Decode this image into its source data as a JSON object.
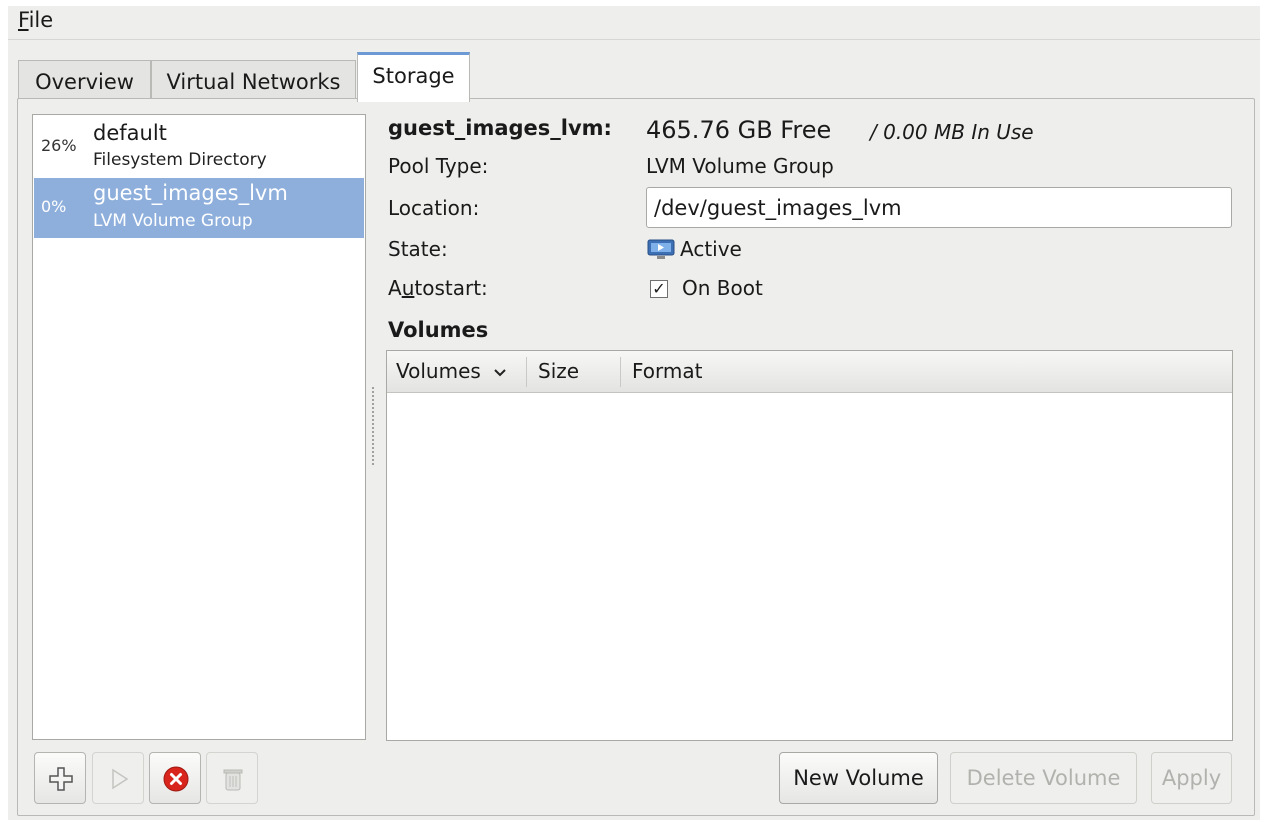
{
  "menu": {
    "file_label": "File"
  },
  "tabs": [
    {
      "label": "Overview",
      "active": false
    },
    {
      "label": "Virtual Networks",
      "active": false
    },
    {
      "label": "Storage",
      "active": true
    }
  ],
  "pools": [
    {
      "percent": "26%",
      "name": "default",
      "type": "Filesystem Directory",
      "selected": false
    },
    {
      "percent": "0%",
      "name": "guest_images_lvm",
      "type": "LVM Volume Group",
      "selected": true
    }
  ],
  "details": {
    "pool_name": "guest_images_lvm:",
    "free": "465.76 GB Free",
    "in_use": "/ 0.00 MB In Use",
    "pool_type_label": "Pool Type:",
    "pool_type_value": "LVM Volume Group",
    "location_label": "Location:",
    "location_value": "/dev/guest_images_lvm",
    "state_label": "State:",
    "state_value": "Active",
    "state_icon": "monitor-active-icon",
    "autostart_label": "Autostart:",
    "autostart_checked": true,
    "autostart_value": "On Boot"
  },
  "volumes": {
    "section_title": "Volumes",
    "columns": [
      "Volumes",
      "Size",
      "Format"
    ],
    "sort_icon": "chevron-down-icon",
    "rows": []
  },
  "toolbar": {
    "add_icon": "add-icon",
    "start_icon": "play-icon",
    "stop_icon": "stop-icon",
    "delete_icon": "trash-icon"
  },
  "buttons": {
    "new_volume": "New Volume",
    "delete_volume": "Delete Volume",
    "apply": "Apply"
  },
  "colors": {
    "selection": "#8eafdc",
    "tab_accent": "#6d9ad4",
    "stop_red": "#d9261c"
  }
}
